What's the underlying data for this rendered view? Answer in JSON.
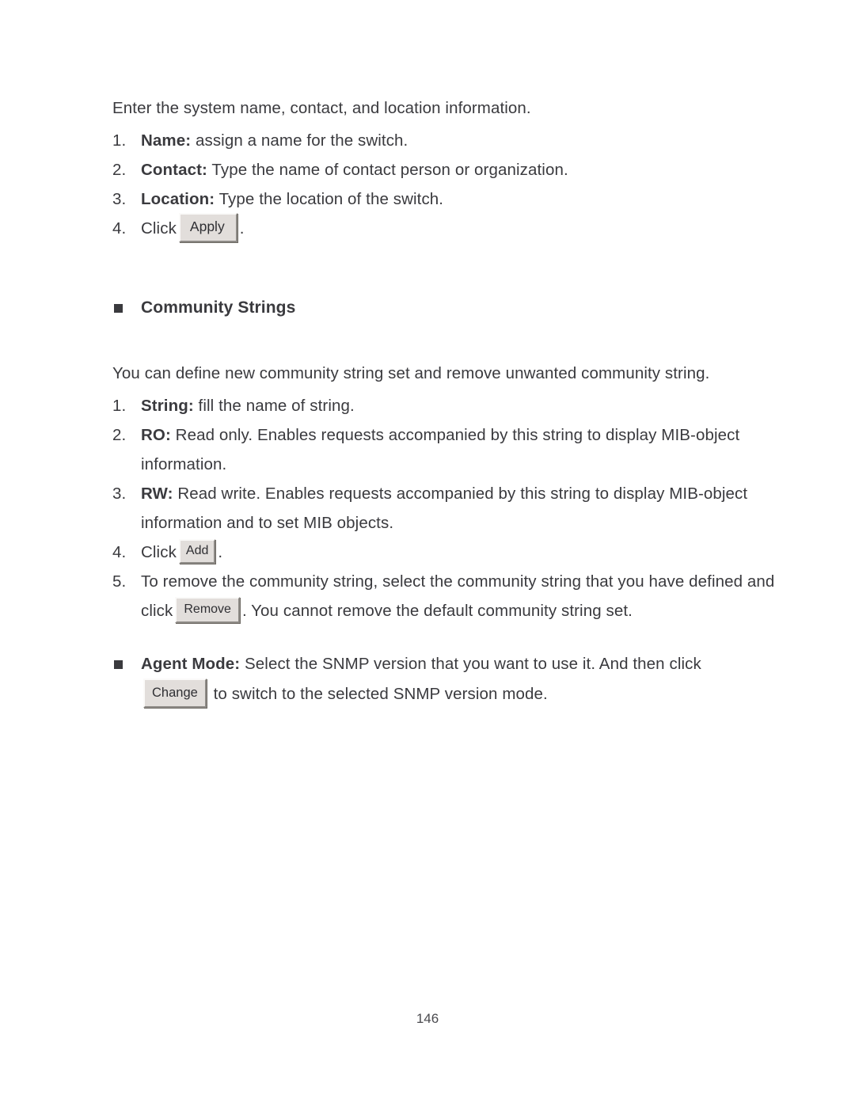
{
  "document": {
    "page_number": "146",
    "text_color": "#3a3a3e",
    "button_face_color": "#e2dedb"
  },
  "section_system": {
    "intro": "Enter the system name, contact, and location information.",
    "items": [
      {
        "marker": "1.",
        "label": "Name:",
        "text": " assign a name for the switch."
      },
      {
        "marker": "2.",
        "label": "Contact:",
        "text": " Type the name of contact person or organization."
      },
      {
        "marker": "3.",
        "label": "Location:",
        "text": " Type the location of the switch."
      },
      {
        "marker": "4.",
        "click_word": "Click",
        "button": "Apply",
        "trailing": "."
      }
    ]
  },
  "section_community": {
    "bullet": "square-bullet",
    "heading": "Community Strings",
    "intro": "You can define new community string set and remove unwanted community string.",
    "items": [
      {
        "marker": "1.",
        "label": "String:",
        "text": " fill the name of string."
      },
      {
        "marker": "2.",
        "label": "RO:",
        "text": " Read only. Enables requests accompanied by this string to display MIB-object information."
      },
      {
        "marker": "3.",
        "label": "RW:",
        "text": " Read write. Enables requests accompanied by this string to display MIB-object information and to set MIB objects."
      },
      {
        "marker": "4.",
        "click_word": "Click",
        "button": "Add",
        "trailing": "."
      },
      {
        "marker": "5.",
        "text_before": "To remove the community string, select the community string that you have defined and click",
        "button": "Remove",
        "text_after": ". You cannot remove the default community string set."
      }
    ]
  },
  "section_agent_mode": {
    "bullet": "square-bullet",
    "label": "Agent Mode:",
    "text_line1": " Select the SNMP version that you want to use it. And then click",
    "button": "Change",
    "text_line2": "to switch to the selected SNMP version mode."
  }
}
